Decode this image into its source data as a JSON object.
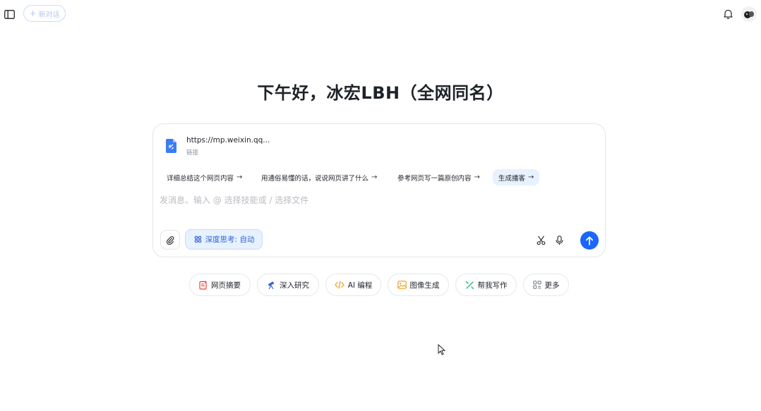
{
  "header": {
    "new_chat_label": "新对话"
  },
  "greeting": "下午好，冰宏LBH（全网同名）",
  "attachment": {
    "name": "https://mp.weixin.qq...",
    "type": "链接"
  },
  "suggestions": [
    {
      "label": "详细总结这个网页内容"
    },
    {
      "label": "用通俗易懂的话，说说网页讲了什么"
    },
    {
      "label": "参考网页写一篇原创内容"
    },
    {
      "label": "生成播客"
    }
  ],
  "input": {
    "placeholder": "发消息、输入 @ 选择技能或 / 选择文件"
  },
  "deep_think_label": "深度思考: 自动",
  "tools": [
    {
      "label": "网页摘要",
      "icon": "web-summary-icon",
      "color": "#e8453c"
    },
    {
      "label": "深入研究",
      "icon": "telescope-icon",
      "color": "#2f63d6"
    },
    {
      "label": "AI 编程",
      "icon": "code-icon",
      "color": "#f0a020"
    },
    {
      "label": "图像生成",
      "icon": "image-icon",
      "color": "#f0a020"
    },
    {
      "label": "帮我写作",
      "icon": "pen-icon",
      "color": "#2bb673"
    },
    {
      "label": "更多",
      "icon": "grid-icon",
      "color": "#7a8190"
    }
  ],
  "colors": {
    "accent": "#1a66ff",
    "chip_bg": "#e8f1fe"
  }
}
